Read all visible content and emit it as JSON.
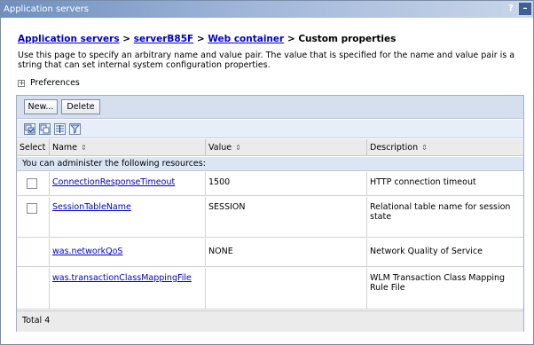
{
  "window": {
    "title": "Application servers",
    "help_label": "?",
    "minimize_label": "–"
  },
  "breadcrumb": {
    "items": [
      "Application servers",
      "serverB85F",
      "Web container"
    ],
    "separator": ">",
    "current": "Custom properties"
  },
  "description": "Use this page to specify an arbitrary name and value pair. The value that is specified for the name and value pair is a string that can set internal system configuration properties.",
  "preferences": {
    "label": "Preferences",
    "toggle_glyph": "+"
  },
  "toolbar": {
    "new_label": "New...",
    "delete_label": "Delete"
  },
  "icons": [
    "select-all-icon",
    "deselect-all-icon",
    "add-filter-icon",
    "clear-filter-icon"
  ],
  "table": {
    "headers": {
      "select": "Select",
      "name": "Name",
      "value": "Value",
      "description": "Description"
    },
    "sort_glyph": "⇕",
    "info": "You can administer the following resources:",
    "rows": [
      {
        "name": "ConnectionResponseTimeout",
        "value": "1500",
        "description": "HTTP connection timeout",
        "has_checkbox": true
      },
      {
        "name": "SessionTableName",
        "value": "SESSION",
        "description": "Relational table name for session state",
        "has_checkbox": true
      },
      {
        "name": "was.networkQoS",
        "value": "NONE",
        "description": "Network Quality of Service",
        "has_checkbox": false
      },
      {
        "name": "was.transactionClassMappingFile",
        "value": "",
        "description": "WLM Transaction Class Mapping Rule File",
        "has_checkbox": false
      }
    ],
    "total": "Total 4"
  },
  "colors": {
    "link": "#0000cc",
    "titlebar": "#6f8fbf",
    "header_bg": "#ebebeb",
    "info_bg": "#dce5f3"
  }
}
